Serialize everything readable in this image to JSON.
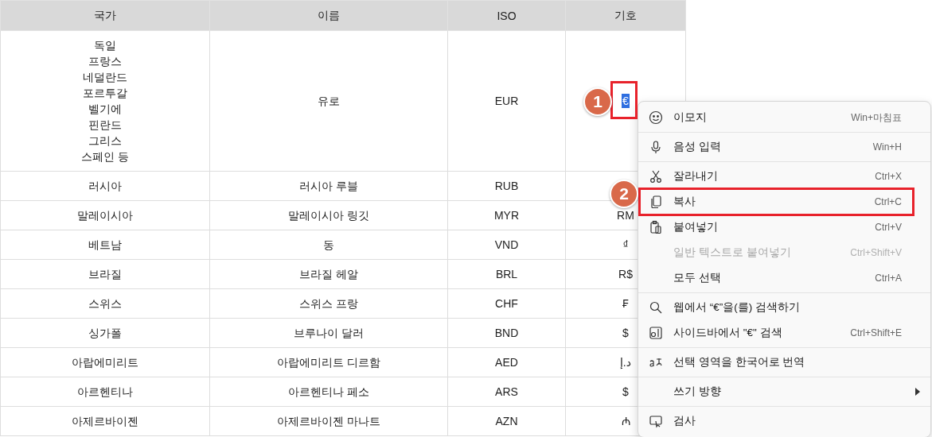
{
  "table": {
    "columns": [
      "국가",
      "이름",
      "ISO",
      "기호"
    ],
    "rows": [
      {
        "country": "독일\n프랑스\n네덜란드\n포르투갈\n벨기에\n핀란드\n그리스\n스페인 등",
        "name": "유로",
        "iso": "EUR",
        "symbol": "€",
        "symbol_selected": true
      },
      {
        "country": "러시아",
        "name": "러시아 루블",
        "iso": "RUB"
      },
      {
        "country": "말레이시아",
        "name": "말레이시아 링깃",
        "iso": "MYR",
        "symbol": "RM",
        "symbol_selected": false
      },
      {
        "country": "베트남",
        "name": "동",
        "iso": "VND",
        "symbol": "₫",
        "symbol_selected": false
      },
      {
        "country": "브라질",
        "name": "브라질 헤알",
        "iso": "BRL",
        "symbol": "R$",
        "symbol_selected": false
      },
      {
        "country": "스위스",
        "name": "스위스 프랑",
        "iso": "CHF",
        "symbol": "₣",
        "symbol_selected": false
      },
      {
        "country": "싱가폴",
        "name": "브루나이 달러",
        "iso": "BND",
        "symbol": "$",
        "symbol_selected": false
      },
      {
        "country": "아랍에미리트",
        "name": "아랍에미리트 디르함",
        "iso": "AED",
        "symbol": "د.إ",
        "symbol_selected": false
      },
      {
        "country": "아르헨티나",
        "name": "아르헨티나 페소",
        "iso": "ARS",
        "symbol": "$",
        "symbol_selected": false
      },
      {
        "country": "아제르바이젠",
        "name": "아제르바이젠 마나트",
        "iso": "AZN",
        "symbol": "₼",
        "symbol_selected": false
      }
    ]
  },
  "context_menu": {
    "items": [
      {
        "kind": "item",
        "label": "이모지",
        "shortcut": "Win+마침표",
        "disabled": false,
        "submenu": false,
        "annotated": false
      },
      {
        "kind": "divider"
      },
      {
        "kind": "item",
        "label": "음성 입력",
        "shortcut": "Win+H",
        "disabled": false,
        "submenu": false,
        "annotated": false
      },
      {
        "kind": "divider"
      },
      {
        "kind": "item",
        "label": "잘라내기",
        "shortcut": "Ctrl+X",
        "disabled": false,
        "submenu": false,
        "annotated": false
      },
      {
        "kind": "item",
        "label": "복사",
        "shortcut": "Ctrl+C",
        "disabled": false,
        "submenu": false,
        "annotated": true
      },
      {
        "kind": "item",
        "label": "붙여넣기",
        "shortcut": "Ctrl+V",
        "disabled": false,
        "submenu": false,
        "annotated": false
      },
      {
        "kind": "item",
        "label": "일반 텍스트로 붙여넣기",
        "shortcut": "Ctrl+Shift+V",
        "disabled": true,
        "submenu": false,
        "annotated": false
      },
      {
        "kind": "item",
        "label": "모두 선택",
        "shortcut": "Ctrl+A",
        "disabled": false,
        "submenu": false,
        "annotated": false
      },
      {
        "kind": "divider"
      },
      {
        "kind": "item",
        "label": "웹에서 “€”을(를) 검색하기",
        "disabled": false,
        "submenu": false,
        "annotated": false
      },
      {
        "kind": "item",
        "label": "사이드바에서 \"€\" 검색",
        "shortcut": "Ctrl+Shift+E",
        "disabled": false,
        "submenu": false,
        "annotated": false
      },
      {
        "kind": "divider"
      },
      {
        "kind": "item",
        "label": "선택 영역을 한국어로 번역",
        "disabled": false,
        "submenu": false,
        "annotated": false
      },
      {
        "kind": "divider"
      },
      {
        "kind": "item",
        "label": "쓰기 방향",
        "disabled": false,
        "submenu": true,
        "annotated": false
      },
      {
        "kind": "divider"
      },
      {
        "kind": "item",
        "label": "검사",
        "disabled": false,
        "submenu": false,
        "annotated": false
      }
    ]
  },
  "annotations": [
    {
      "label": "1"
    },
    {
      "label": "2"
    }
  ]
}
